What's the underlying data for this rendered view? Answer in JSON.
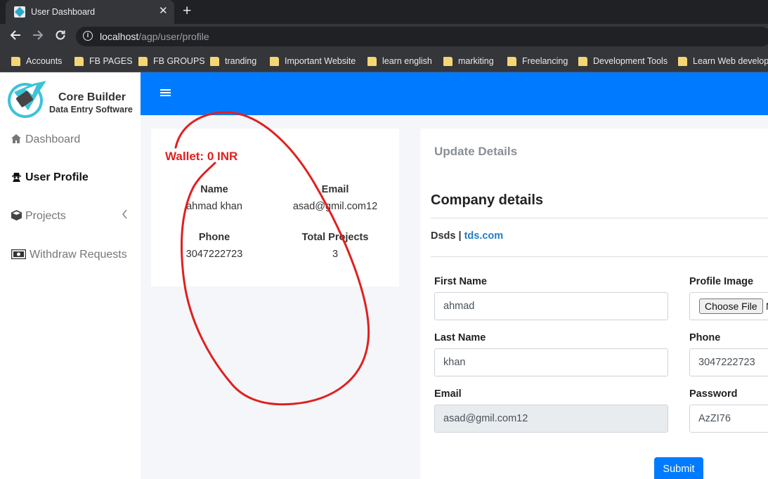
{
  "browser": {
    "tab_title": "User Dashboard",
    "tab_close": "✕",
    "new_tab": "+",
    "url_host": "localhost",
    "url_path": "/agp/user/profile",
    "bookmarks": [
      "Accounts",
      "FB PAGES",
      "FB GROUPS",
      "tranding",
      "Important Website",
      "learn english",
      "markiting",
      "Freelancing",
      "Development Tools",
      "Learn Web develop..."
    ]
  },
  "brand": {
    "line1": "Core Builder",
    "line2": "Data Entry Software"
  },
  "sidebar": {
    "items": [
      {
        "label": "Dashboard",
        "icon": "home-icon"
      },
      {
        "label": "User Profile",
        "icon": "user-secret-icon"
      },
      {
        "label": "Projects",
        "icon": "cube-icon"
      },
      {
        "label": "Withdraw Requests",
        "icon": "money-icon"
      }
    ]
  },
  "wallet_card": {
    "wallet": "Wallet: 0 INR",
    "name_label": "Name",
    "name_value": "ahmad khan",
    "email_label": "Email",
    "email_value": "asad@gmil.com12",
    "phone_label": "Phone",
    "phone_value": "3047222723",
    "projects_label": "Total Projects",
    "projects_value": "3"
  },
  "details": {
    "heading": "Update Details",
    "section": "Company details",
    "company_name": "Dsds",
    "separator": " | ",
    "company_site": "tds.com",
    "first_name_label": "First Name",
    "first_name_value": "ahmad",
    "profile_image_label": "Profile Image",
    "choose_file": "Choose File",
    "file_status": "N",
    "last_name_label": "Last Name",
    "last_name_value": "khan",
    "phone_label": "Phone",
    "phone_value": "3047222723",
    "email_label": "Email",
    "email_value": "asad@gmil.com12",
    "password_label": "Password",
    "password_value": "AzZI76",
    "submit": "Submit"
  },
  "colors": {
    "primary": "#007bff",
    "annotation": "#e0201e"
  }
}
